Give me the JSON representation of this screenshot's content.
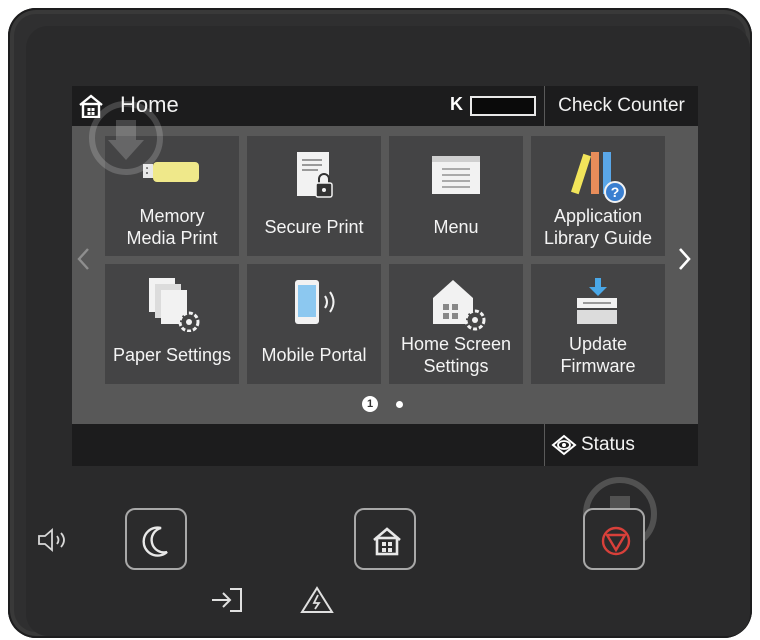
{
  "header": {
    "title": "Home",
    "toner_label": "K",
    "check_counter": "Check Counter"
  },
  "tiles": [
    {
      "label": "Memory\nMedia Print",
      "icon": "usb-memory-icon"
    },
    {
      "label": "Secure Print",
      "icon": "secure-print-icon"
    },
    {
      "label": "Menu",
      "icon": "menu-icon"
    },
    {
      "label": "Application\nLibrary Guide",
      "icon": "application-library-icon"
    },
    {
      "label": "Paper Settings",
      "icon": "paper-settings-icon"
    },
    {
      "label": "Mobile Portal",
      "icon": "mobile-portal-icon"
    },
    {
      "label": "Home Screen\nSettings",
      "icon": "home-screen-settings-icon"
    },
    {
      "label": "Update\nFirmware",
      "icon": "update-firmware-icon"
    }
  ],
  "pager": {
    "current": "1",
    "total_pages": 2
  },
  "footer": {
    "status_monitor": "Status Monitor"
  },
  "colors": {
    "screen_bg": "#585858",
    "tile_bg": "#444445",
    "bar_bg": "#1c1c1d",
    "stop_red": "#d8403a"
  },
  "hardware_buttons": [
    "sleep-moon-icon",
    "home-icon",
    "stop-icon"
  ],
  "indicators": [
    "volume-icon",
    "data-in-icon",
    "error-warning-icon"
  ]
}
